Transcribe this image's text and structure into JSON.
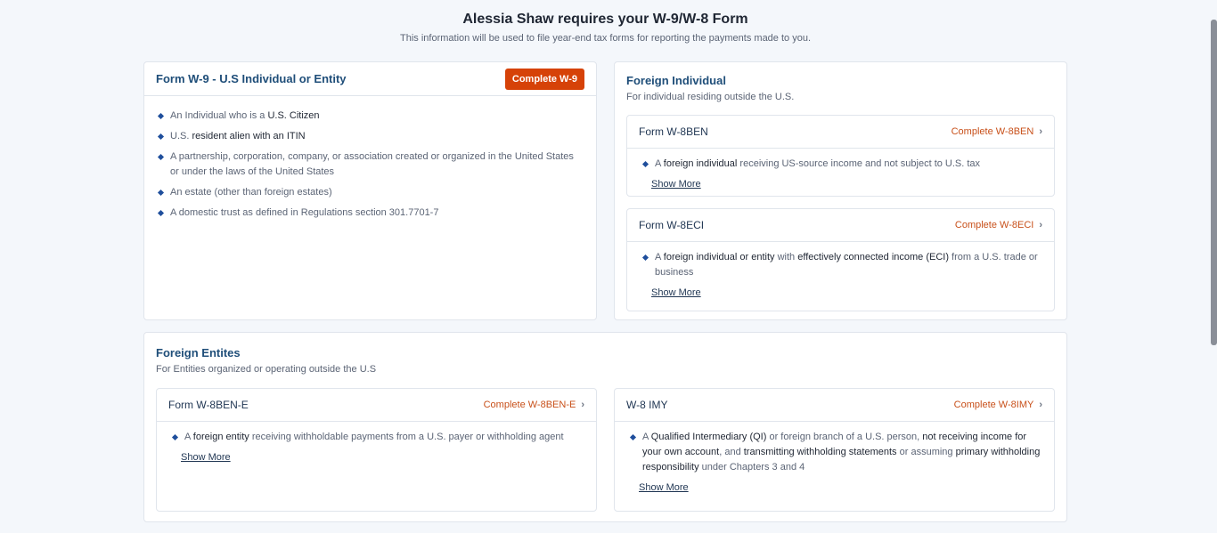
{
  "header": {
    "title": "Alessia Shaw requires your W-9/W-8 Form",
    "subtitle": "This information will be used to file year-end tax forms for reporting the payments made to you."
  },
  "w9": {
    "title": "Form W-9 - U.S Individual or Entity",
    "button": "Complete W-9",
    "items": [
      [
        "An Individual who is a ",
        "U.S. Citizen",
        ""
      ],
      [
        "U.S. ",
        "resident alien with an ITIN",
        ""
      ],
      [
        "A partnership, corporation, company, or association created or organized in the United States or under the laws of the United States",
        "",
        ""
      ],
      [
        "An estate (other than foreign estates)",
        "",
        ""
      ],
      [
        "A domestic trust as defined in Regulations section 301.7701-7",
        "",
        ""
      ]
    ]
  },
  "foreign_individual": {
    "title": "Foreign Individual",
    "subtitle": "For individual residing outside the U.S.",
    "w8ben": {
      "title": "Form W-8BEN",
      "link": "Complete W-8BEN",
      "t1": "A ",
      "b1": "foreign individual",
      "t2": " receiving US-source income and not subject to U.S. tax",
      "show_more": "Show More"
    },
    "w8eci": {
      "title": "Form W-8ECI",
      "link": "Complete W-8ECI",
      "t1": "A ",
      "b1": "foreign individual or entity",
      "t2": " with ",
      "b2": "effectively connected income (ECI)",
      "t3": " from a U.S. trade or business",
      "show_more": "Show More"
    }
  },
  "foreign_entities": {
    "title": "Foreign Entites",
    "subtitle": "For Entities organized or operating outside the U.S",
    "w8bene": {
      "title": "Form W-8BEN-E",
      "link": "Complete W-8BEN-E",
      "t1": "A ",
      "b1": "foreign entity",
      "t2": " receiving withholdable payments from a U.S. payer or withholding agent",
      "show_more": "Show More"
    },
    "w8imy": {
      "title": "W-8 IMY",
      "link": "Complete W-8IMY",
      "t1": "A ",
      "b1": "Qualified Intermediary (QI)",
      "t2": " or foreign branch of a U.S. person, ",
      "b2": "not receiving income for your own account",
      "t3": ", and ",
      "b3": "transmitting withholding statements",
      "t4": " or assuming ",
      "b4": "primary withholding responsibility",
      "t5": " under Chapters 3 and 4",
      "show_more": "Show More"
    }
  },
  "icons": {
    "chevron": "chevron-right-icon",
    "bullet": "diamond-bullet-icon"
  },
  "colors": {
    "accent": "#d64208",
    "link": "#c8501a",
    "heading": "#1f4e79",
    "bullet": "#1f4e9c"
  }
}
